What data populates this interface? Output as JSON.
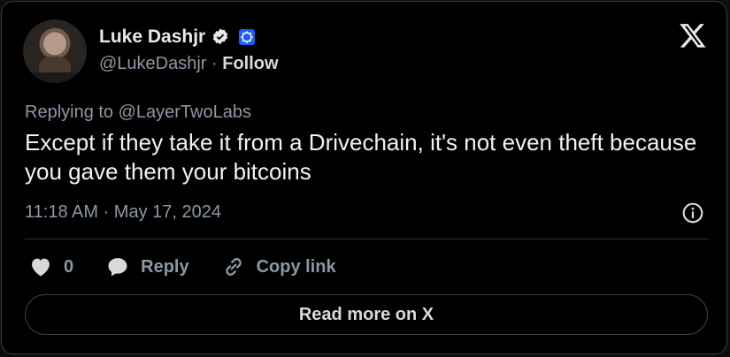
{
  "author": {
    "display_name": "Luke Dashjr",
    "handle": "@LukeDashjr",
    "separator": " · ",
    "follow_label": "Follow",
    "verified_icon": "verified-badge-icon",
    "affiliate_icon": "affiliate-badge-icon"
  },
  "brand": {
    "logo": "x-logo-icon"
  },
  "tweet": {
    "reply_to": "Replying to @LayerTwoLabs",
    "text": "Except if they take it from a Drivechain, it's not even theft because you gave them your bitcoins",
    "timestamp": "11:18 AM · May 17, 2024"
  },
  "actions": {
    "like_count": "0",
    "reply_label": "Reply",
    "copy_link_label": "Copy link"
  },
  "footer": {
    "read_more_label": "Read more on X"
  },
  "colors": {
    "background": "#000000",
    "border": "#3a3d40",
    "text_primary": "#e7e9ea",
    "text_secondary": "#8b98a5",
    "like_heart": "#8b98a5",
    "affiliate_badge": "#1d5cff"
  }
}
